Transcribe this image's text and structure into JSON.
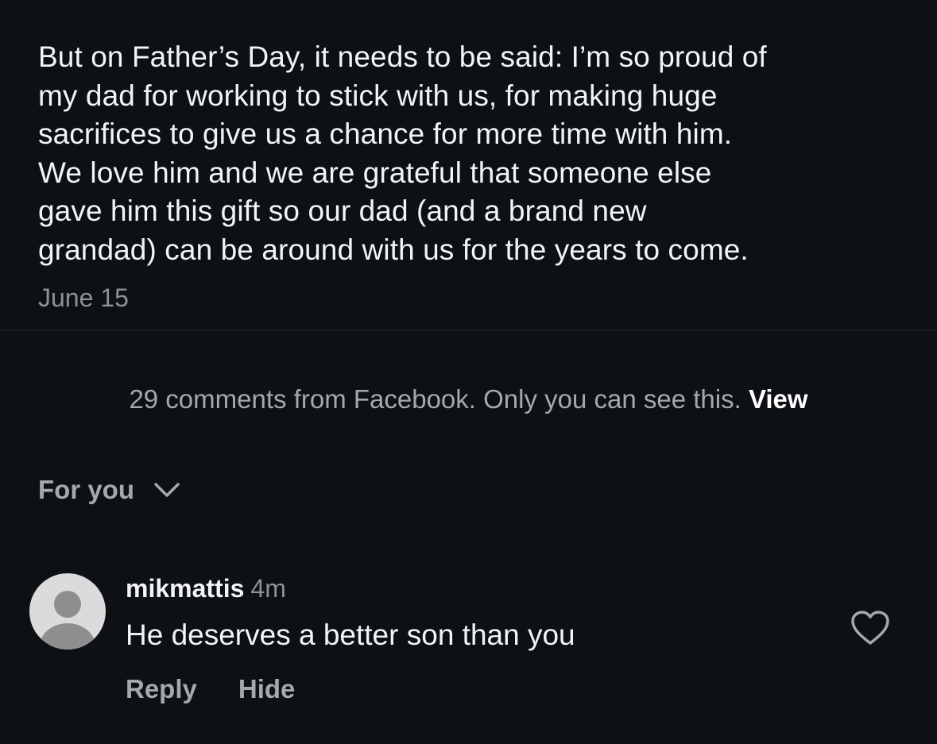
{
  "post": {
    "caption_lines": [
      "But on Father’s Day, it needs to be said: I’m so proud of",
      "my dad for working to stick with us, for making huge",
      "sacrifices to give us a chance for more time with him.",
      "We love him and we are grateful that someone else",
      "gave him this gift so our dad (and a brand new",
      "grandad) can be around with us for the years to come."
    ],
    "date": "June 15"
  },
  "facebook_notice": {
    "text": "29 comments from Facebook. Only you can see this.",
    "view_label": "View"
  },
  "comments_sort": {
    "label": "For you",
    "icon": "chevron-down-icon"
  },
  "comment": {
    "avatar_icon": "default-avatar-icon",
    "username": "mikmattis",
    "time": "4m",
    "text": "He deserves a better son than you",
    "like_icon": "heart-outline-icon",
    "reply_label": "Reply",
    "hide_label": "Hide"
  },
  "colors": {
    "background": "#0d1015",
    "primary_text": "#f3f4f6",
    "secondary_text": "#8d9198",
    "muted_text": "#a4a8af",
    "divider": "#22262d",
    "avatar_bg": "#dbdbdb",
    "avatar_figure": "#8e8e8e"
  }
}
